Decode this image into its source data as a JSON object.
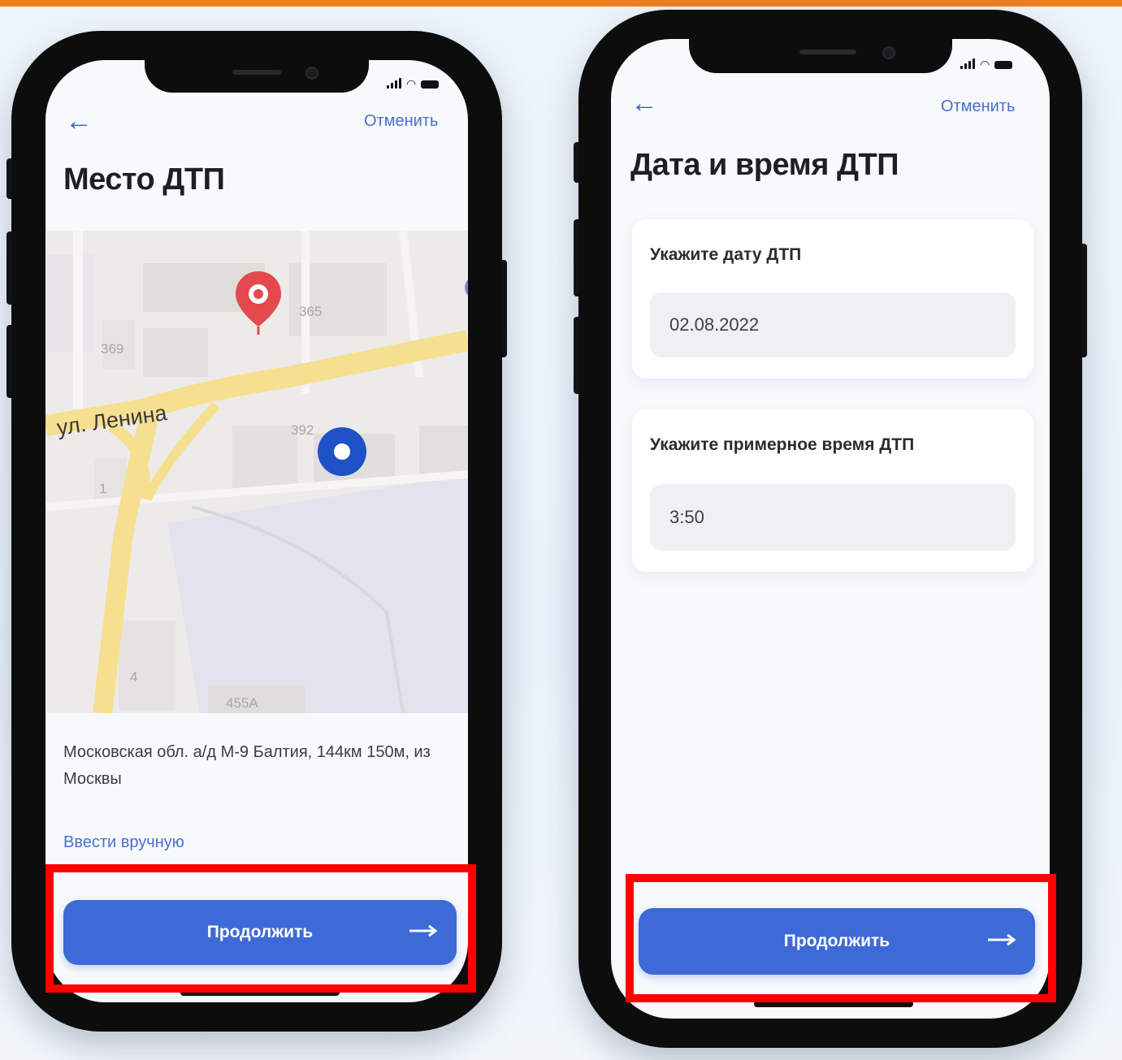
{
  "left_phone": {
    "back_icon": "arrow-left-icon",
    "cancel_label": "Отменить",
    "title": "Место ДТП",
    "map": {
      "street_label": "ул. Ленина",
      "building_numbers": [
        "365",
        "369",
        "392",
        "1",
        "4",
        "455A"
      ],
      "pin_color": "#e5484d",
      "current_location_color": "#1f52c7"
    },
    "address": "Московская обл. а/д М-9 Балтия, 144км 150м, из Москвы",
    "manual_entry_label": "Ввести вручную",
    "continue_label": "Продолжить",
    "continue_icon": "arrow-right-icon"
  },
  "right_phone": {
    "back_icon": "arrow-left-icon",
    "cancel_label": "Отменить",
    "title": "Дата и время ДТП",
    "date_card": {
      "label": "Укажите дату ДТП",
      "value": "02.08.2022"
    },
    "time_card": {
      "label": "Укажите примерное время ДТП",
      "value": "3:50"
    },
    "continue_label": "Продолжить",
    "continue_icon": "arrow-right-icon"
  },
  "colors": {
    "accent": "#3d6ad6",
    "highlight": "#ff0000",
    "top_stripe": "#f07f1d"
  }
}
